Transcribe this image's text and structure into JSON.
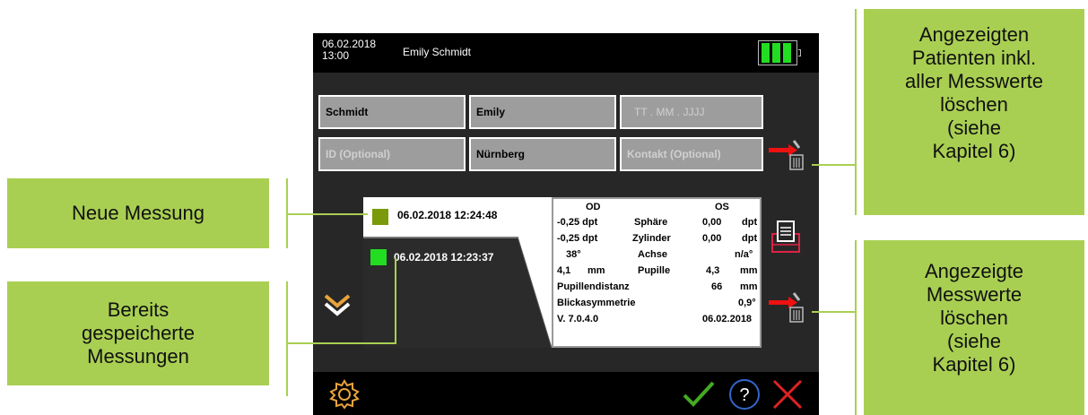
{
  "statusbar": {
    "date": "06.02.2018",
    "time": "13:00",
    "patient_name": "Emily Schmidt",
    "battery_level": 1.0
  },
  "form": {
    "last_name": "Schmidt",
    "first_name": "Emily",
    "birthdate_placeholder": "TT . MM . JJJJ",
    "id_placeholder": "ID (Optional)",
    "city": "Nürnberg",
    "contact_placeholder": "Kontakt (Optional)"
  },
  "measurements": [
    {
      "label": "06.02.2018 12:24:48",
      "color": "#7a9a0a"
    },
    {
      "label": "06.02.2018 12:23:37",
      "color": "#22dd22"
    }
  ],
  "results": {
    "od_header": "OD",
    "os_header": "OS",
    "sphere": {
      "od": "-0,25 dpt",
      "label": "Sphäre",
      "os_val": "0,00",
      "os_unit": "dpt"
    },
    "cylinder": {
      "od": "-0,25 dpt",
      "label": "Zylinder",
      "os_val": "0,00",
      "os_unit": "dpt"
    },
    "axis": {
      "od": "38°",
      "label": "Achse",
      "os": "n/a°"
    },
    "pupil": {
      "od_val": "4,1",
      "od_unit": "mm",
      "label": "Pupille",
      "os_val": "4,3",
      "os_unit": "mm"
    },
    "pd": {
      "label": "Pupillendistanz",
      "value": "66",
      "unit": "mm"
    },
    "asym": {
      "label": "Blickasymmetrie",
      "value": "0,9°"
    },
    "version": "V. 7.0.4.0",
    "date": "06.02.2018"
  },
  "callouts": {
    "new_measurement": "Neue Messung",
    "saved": [
      "Bereits",
      "gespeicherte",
      "Messungen"
    ],
    "delete_patient": [
      "Angezeigten",
      "Patienten inkl.",
      "aller Messwerte",
      "löschen",
      "(siehe",
      "Kapitel 6)"
    ],
    "delete_values": [
      "Angezeigte",
      "Messwerte",
      "löschen",
      "(siehe",
      "Kapitel 6)"
    ]
  },
  "colors": {
    "callout": "#a9cf52",
    "accept": "#44aa22",
    "cancel": "#dd2222",
    "help": "#3366cc",
    "settings": "#e8a33c",
    "delete_arrow": "#ee1111"
  },
  "icons": [
    "battery-icon",
    "delete-patient-icon",
    "print-icon",
    "delete-measurement-icon",
    "expand-down-icon",
    "settings-gear-icon",
    "check-icon",
    "help-icon",
    "close-icon"
  ]
}
